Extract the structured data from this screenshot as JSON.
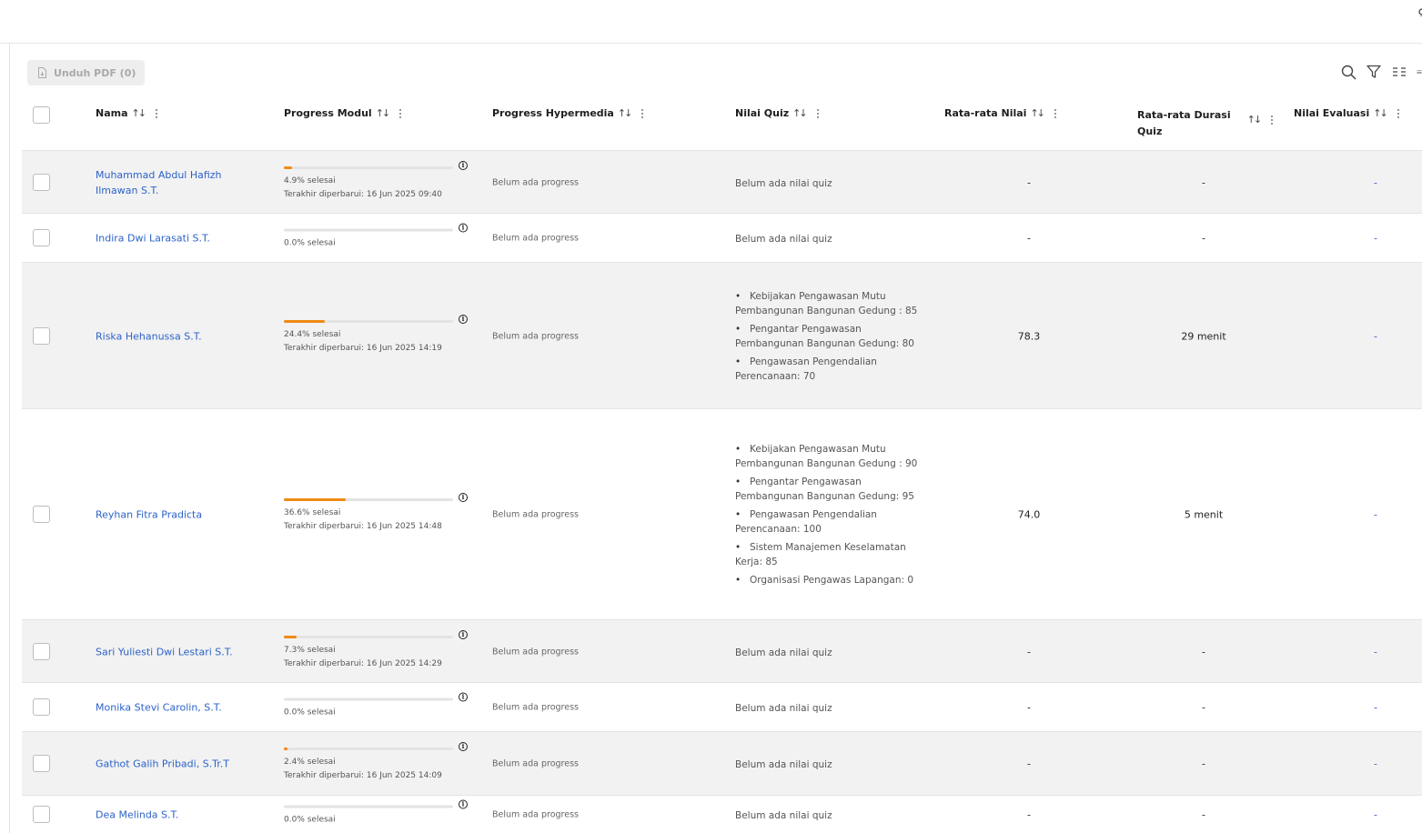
{
  "toolbar": {
    "pdf_button": "Unduh PDF (0)",
    "icons": [
      "search-icon",
      "filter-icon",
      "columns-icon",
      "menu-icon"
    ]
  },
  "columns": {
    "nama": "Nama",
    "progress_modul": "Progress Modul",
    "progress_hypermedia": "Progress Hypermedia",
    "nilai_quiz": "Nilai Quiz",
    "rata_nilai": "Rata-rata Nilai",
    "rata_durasi_1": "Rata-rata Durasi",
    "rata_durasi_2": "Quiz",
    "nilai_evaluasi": "Nilai Evaluasi",
    "sort_glyph": "↑↓"
  },
  "rows": [
    {
      "name": "Muhammad Abdul Hafizh Ilmawan S.T.",
      "progress": 4.9,
      "progress_text": "4.9% selesai",
      "updated": "Terakhir diperbarui: 16 Jun 2025 09:40",
      "hypermedia": "Belum ada progress",
      "quiz_none": "Belum ada nilai quiz",
      "quiz": [],
      "avg": "-",
      "duration": "-",
      "evaluation": "-"
    },
    {
      "name": "Indira Dwi Larasati S.T.",
      "progress": 0,
      "progress_text": "0.0% selesai",
      "updated": "",
      "hypermedia": "Belum ada progress",
      "quiz_none": "Belum ada nilai quiz",
      "quiz": [],
      "avg": "-",
      "duration": "-",
      "evaluation": "-"
    },
    {
      "name": "Riska Hehanussa S.T.",
      "progress": 24.4,
      "progress_text": "24.4% selesai",
      "updated": "Terakhir diperbarui: 16 Jun 2025 14:19",
      "hypermedia": "Belum ada progress",
      "quiz_none": "",
      "quiz": [
        "Kebijakan Pengawasan Mutu Pembangunan Bangunan Gedung : 85",
        "Pengantar Pengawasan Pembangunan Bangunan Gedung: 80",
        "Pengawasan Pengendalian Perencanaan: 70"
      ],
      "avg": "78.3",
      "duration": "29 menit",
      "evaluation": "-"
    },
    {
      "name": "Reyhan Fitra Pradicta",
      "progress": 36.6,
      "progress_text": "36.6% selesai",
      "updated": "Terakhir diperbarui: 16 Jun 2025 14:48",
      "hypermedia": "Belum ada progress",
      "quiz_none": "",
      "quiz": [
        "Kebijakan Pengawasan Mutu Pembangunan Bangunan Gedung : 90",
        "Pengantar Pengawasan Pembangunan Bangunan Gedung: 95",
        "Pengawasan Pengendalian Perencanaan: 100",
        "Sistem Manajemen Keselamatan Kerja: 85",
        "Organisasi Pengawas Lapangan: 0"
      ],
      "avg": "74.0",
      "duration": "5 menit",
      "evaluation": "-"
    },
    {
      "name": "Sari Yuliesti Dwi Lestari S.T.",
      "progress": 7.3,
      "progress_text": "7.3% selesai",
      "updated": "Terakhir diperbarui: 16 Jun 2025 14:29",
      "hypermedia": "Belum ada progress",
      "quiz_none": "Belum ada nilai quiz",
      "quiz": [],
      "avg": "-",
      "duration": "-",
      "evaluation": "-"
    },
    {
      "name": "Monika Stevi Carolin, S.T.",
      "progress": 0,
      "progress_text": "0.0% selesai",
      "updated": "",
      "hypermedia": "Belum ada progress",
      "quiz_none": "Belum ada nilai quiz",
      "quiz": [],
      "avg": "-",
      "duration": "-",
      "evaluation": "-"
    },
    {
      "name": "Gathot Galih Pribadi, S.Tr.T",
      "progress": 2.4,
      "progress_text": "2.4% selesai",
      "updated": "Terakhir diperbarui: 16 Jun 2025 14:09",
      "hypermedia": "Belum ada progress",
      "quiz_none": "Belum ada nilai quiz",
      "quiz": [],
      "avg": "-",
      "duration": "-",
      "evaluation": "-"
    },
    {
      "name": "Dea Melinda S.T.",
      "progress": 0,
      "progress_text": "0.0% selesai",
      "updated": "",
      "hypermedia": "Belum ada progress",
      "quiz_none": "Belum ada nilai quiz",
      "quiz": [],
      "avg": "-",
      "duration": "-",
      "evaluation": "-"
    }
  ]
}
